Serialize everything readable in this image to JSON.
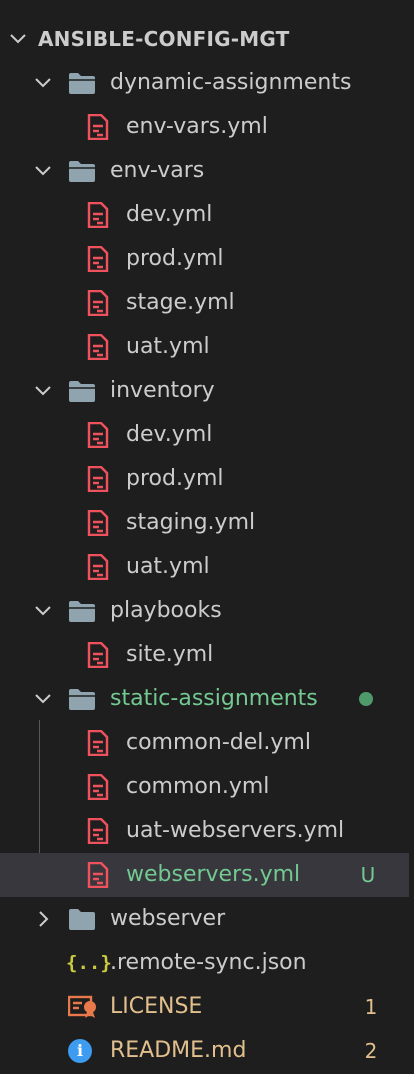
{
  "explorer": {
    "root": {
      "label": "ANSIBLE-CONFIG-MGT"
    },
    "rows": [
      {
        "label": "dynamic-assignments"
      },
      {
        "label": "env-vars.yml"
      },
      {
        "label": "env-vars"
      },
      {
        "label": "dev.yml"
      },
      {
        "label": "prod.yml"
      },
      {
        "label": "stage.yml"
      },
      {
        "label": "uat.yml"
      },
      {
        "label": "inventory"
      },
      {
        "label": "dev.yml"
      },
      {
        "label": "prod.yml"
      },
      {
        "label": "staging.yml"
      },
      {
        "label": "uat.yml"
      },
      {
        "label": "playbooks"
      },
      {
        "label": "site.yml"
      },
      {
        "label": "static-assignments"
      },
      {
        "label": "common-del.yml"
      },
      {
        "label": "common.yml"
      },
      {
        "label": "uat-webservers.yml"
      },
      {
        "label": "webservers.yml",
        "badge": "U"
      },
      {
        "label": "webserver"
      },
      {
        "label": ".remote-sync.json",
        "icon_text": "{..}"
      },
      {
        "label": "LICENSE",
        "badge": "1"
      },
      {
        "label": "README.md",
        "badge": "2",
        "icon_text": "i"
      }
    ]
  },
  "colors": {
    "background": "#1e1e1e",
    "selected_row": "#37373d",
    "folder_icon": "#8fa4ae",
    "yaml_icon": "#f0525d",
    "git_untracked": "#73c991",
    "git_modified": "#e2c08d",
    "modified_dot": "#4e9a6a",
    "json_icon": "#cbcb41",
    "license_icon": "#e8794a",
    "info_icon": "#3e9cf0"
  },
  "icons": {
    "chevron_open": "chevron-down-icon",
    "chevron_closed": "chevron-right-icon",
    "folder": "folder-icon",
    "yaml": "yaml-file-icon",
    "json": "json-file-icon",
    "license": "license-file-icon",
    "info": "info-file-icon"
  }
}
